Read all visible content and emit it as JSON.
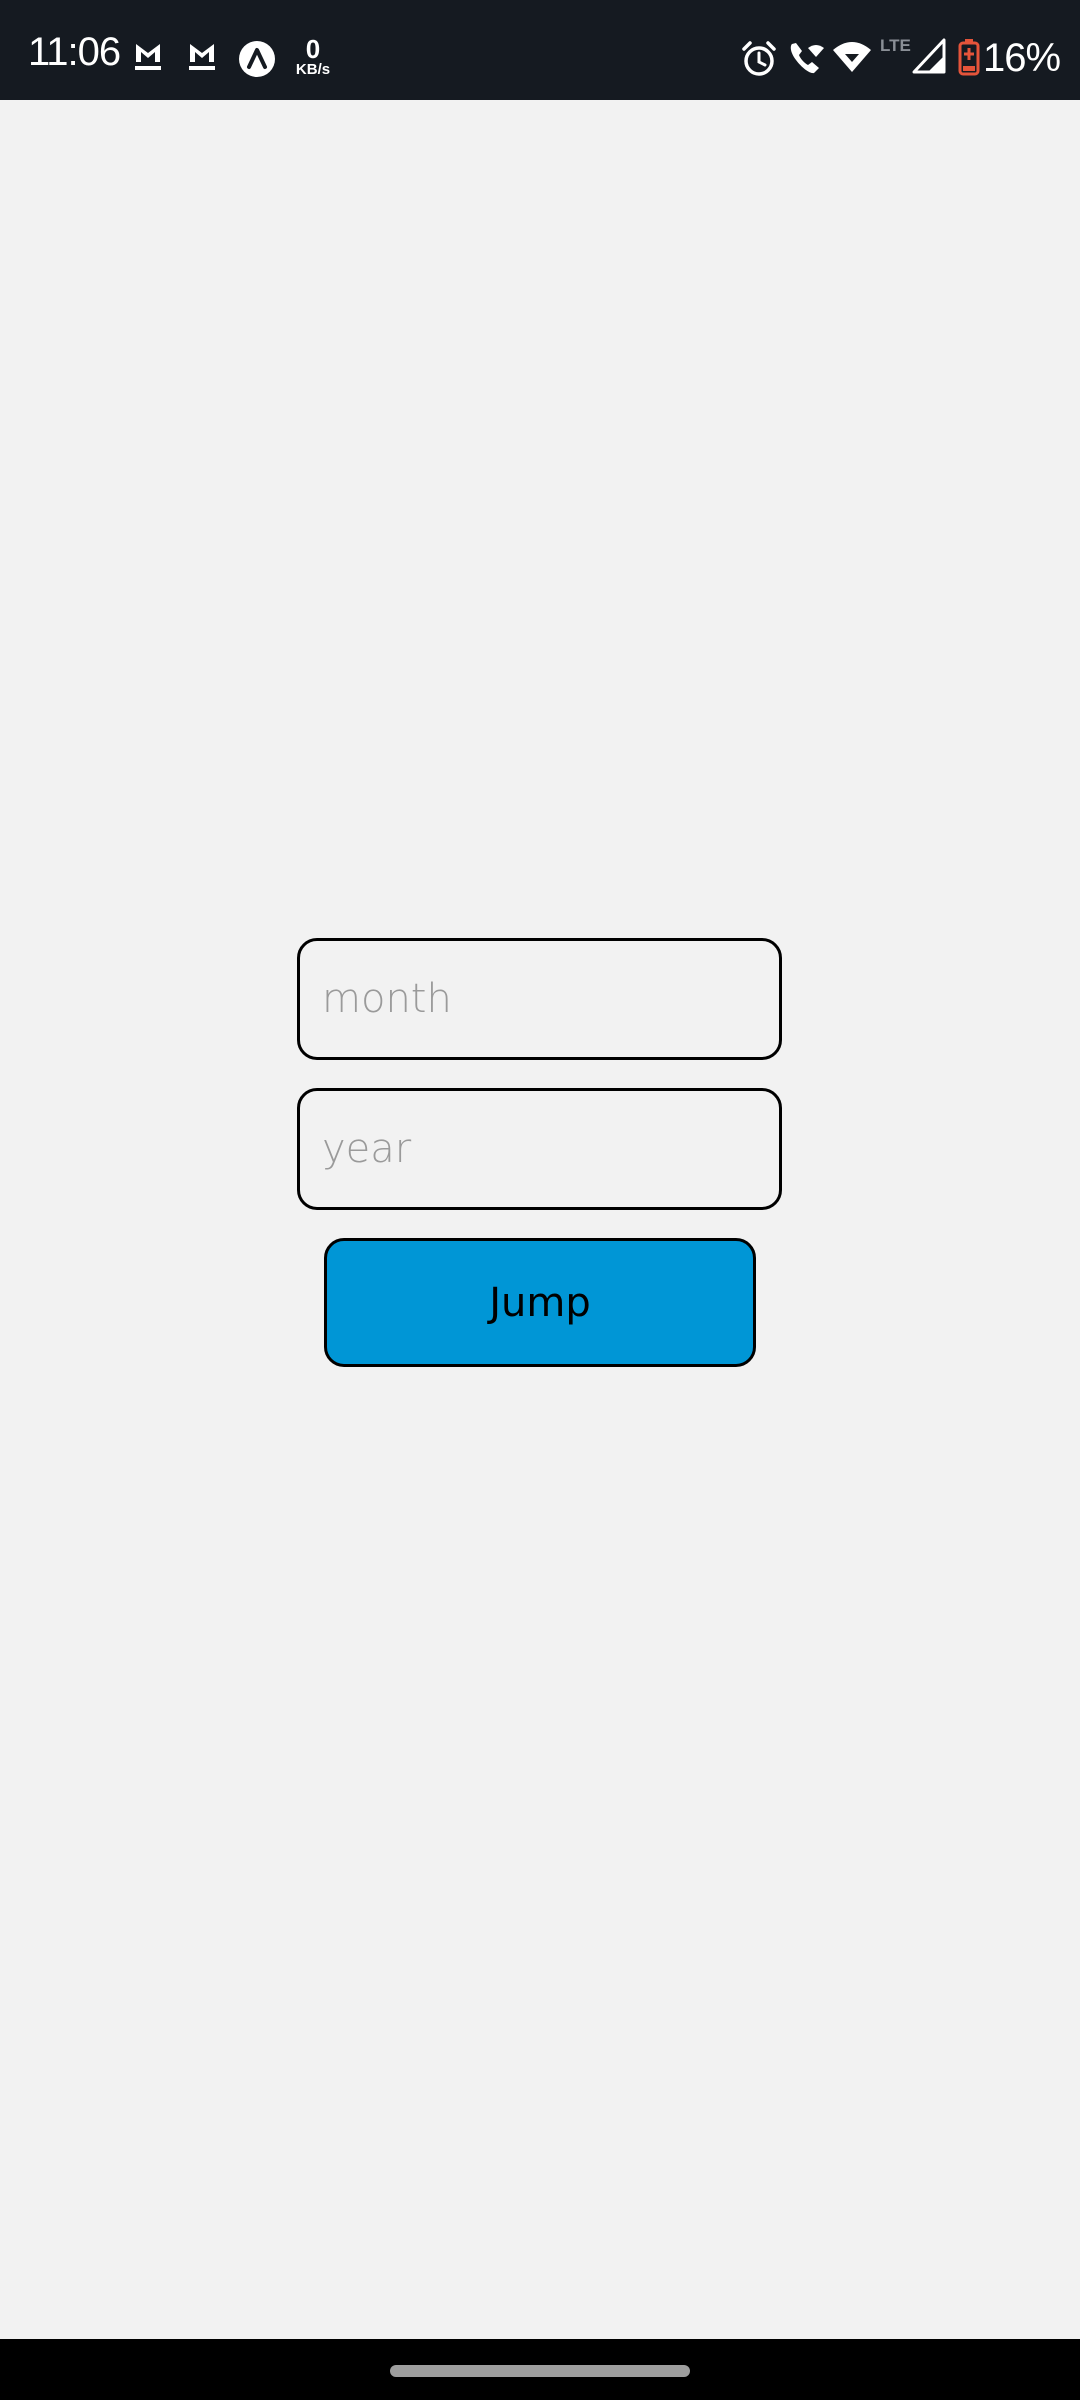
{
  "status_bar": {
    "time": "11:06",
    "net_speed_value": "0",
    "net_speed_unit": "KB/s",
    "network_type": "LTE",
    "battery_percent": "16%",
    "battery_color": "#e5543a",
    "icons": [
      "gmail-icon",
      "gmail-icon",
      "arc-app-icon",
      "alarm-icon",
      "wifi-call-icon",
      "wifi-icon",
      "signal-icon",
      "battery-icon"
    ]
  },
  "form": {
    "month_placeholder": "month",
    "year_placeholder": "year",
    "month_value": "",
    "year_value": "",
    "jump_label": "Jump",
    "button_color": "#0096d6"
  }
}
